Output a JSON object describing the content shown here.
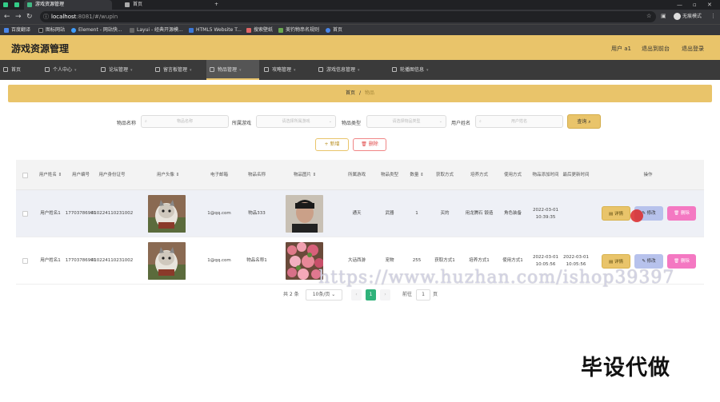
{
  "browser": {
    "tabs": [
      {
        "label": "游戏资源管理",
        "active": true
      },
      {
        "label": "首页",
        "active": false
      }
    ],
    "url_host": "localhost",
    "url_rest": ":8081/#/wupin",
    "profile_label": "无痕模式",
    "bookmarks": [
      "百度翻译",
      "图标网站",
      "Element - 网站快...",
      "Layui - 经典开源模...",
      "HTML5 Website T...",
      "搜索壁纸",
      "美钓物串名规则",
      "首页"
    ]
  },
  "header": {
    "title": "游戏资源管理",
    "user_label": "用户 a1",
    "to_front_label": "退出到前台",
    "logout_label": "退出登录"
  },
  "nav": [
    "首页",
    "个人中心",
    "论坛管理",
    "留言板管理",
    "物品管理",
    "攻略管理",
    "游戏信息管理",
    "轮播图信息"
  ],
  "breadcrumb": {
    "home": "首页",
    "sep": "/",
    "current": "物品"
  },
  "search": {
    "fields": [
      {
        "label": "物品名称",
        "placeholder": "物品名称"
      },
      {
        "label": "所属游戏",
        "placeholder": "请选择所属游戏"
      },
      {
        "label": "物品类型",
        "placeholder": "请选择物品类型"
      },
      {
        "label": "用户姓名",
        "placeholder": "用户姓名"
      }
    ],
    "search_label": "查询",
    "add_label": "新增",
    "delete_label": "删除"
  },
  "table": {
    "headers": [
      "用户姓名",
      "用户编号",
      "用户身份证号",
      "用户头像",
      "电子邮箱",
      "物品名称",
      "物品图片",
      "所属游戏",
      "物品类型",
      "数量",
      "获取方式",
      "培养方式",
      "使用方式",
      "物品添加时间",
      "最后更新时间",
      "操作"
    ],
    "rows": [
      {
        "name": "用户姓名1",
        "id": "17703786901",
        "idcard": "410224110231002",
        "email": "1@qq.com",
        "item": "物品333",
        "game": "通天",
        "type": "武器",
        "qty": "1",
        "get": "买的",
        "train": "用龙腾石 锻造",
        "use": "角色装备",
        "added": "2022-03-01 10:39:35",
        "updated": ""
      },
      {
        "name": "用户姓名1",
        "id": "17703786901",
        "idcard": "410224110231002",
        "email": "1@qq.com",
        "item": "物品名称1",
        "game": "大话西游",
        "type": "宠物",
        "qty": "255",
        "get": "获取方式1",
        "train": "培养方式1",
        "use": "使用方式1",
        "added": "2022-03-01 10:05:56",
        "updated": "2022-03-01 10:05:56"
      }
    ],
    "op_detail": "详情",
    "op_edit": "修改",
    "op_delete": "删除"
  },
  "pager": {
    "total": "共 2 条",
    "size": "10条/页",
    "current": "1",
    "goto": "前往",
    "goto_value": "1",
    "page_unit": "页"
  },
  "watermark": "https://www.huzhan.com/ishop39397",
  "overlay_text": "毕设代做",
  "colors": {
    "accent": "#e9c46a",
    "nav_bg": "#3a3a3a",
    "page_active": "#2fb27a",
    "delete_pink": "#f478c2",
    "edit_blue": "#b7c2ec"
  }
}
